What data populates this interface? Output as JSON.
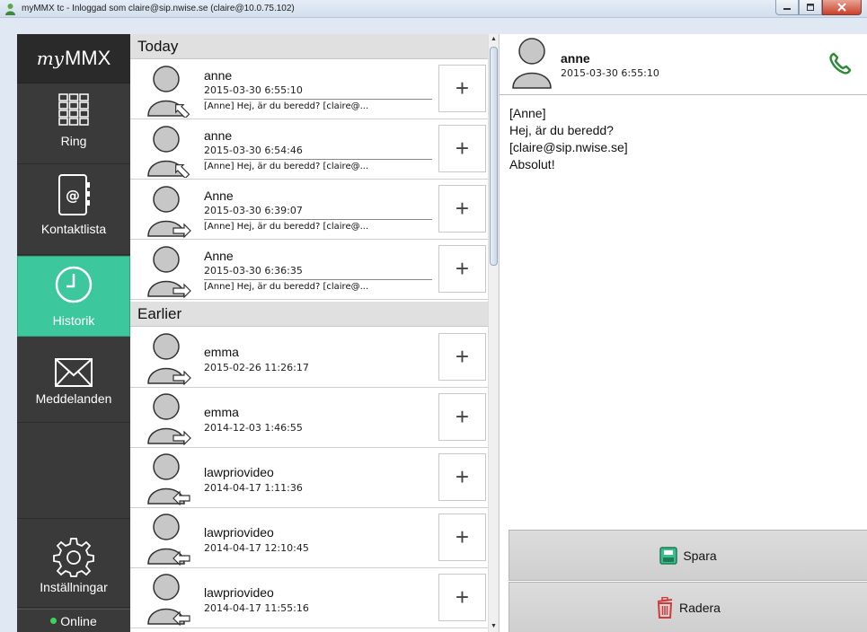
{
  "window": {
    "title": "myMMX tc - Inloggad som claire@sip.nwise.se (claire@10.0.75.102)"
  },
  "sidebar": {
    "logo_prefix": "my",
    "logo_text": "MMX",
    "items": [
      {
        "label": "Ring",
        "icon": "dialpad-icon"
      },
      {
        "label": "Kontaktlista",
        "icon": "contacts-book-icon"
      },
      {
        "label": "Historik",
        "icon": "clock-icon",
        "active": true
      },
      {
        "label": "Meddelanden",
        "icon": "envelope-icon"
      },
      {
        "label": "Inställningar",
        "icon": "gear-icon"
      }
    ],
    "status": "Online",
    "status_color": "#3fd35a",
    "active_color": "#3cc89c"
  },
  "history": {
    "sections": [
      {
        "title": "Today",
        "rows": [
          {
            "name": "anne",
            "time": "2015-03-30 6:55:10",
            "preview": "[Anne] Hej, är du beredd? [claire@...",
            "direction": "incoming"
          },
          {
            "name": "anne",
            "time": "2015-03-30 6:54:46",
            "preview": "[Anne] Hej, är du beredd? [claire@...",
            "direction": "incoming"
          },
          {
            "name": "Anne",
            "time": "2015-03-30 6:39:07",
            "preview": "[Anne] Hej, är du beredd? [claire@...",
            "direction": "outgoing"
          },
          {
            "name": "Anne",
            "time": "2015-03-30 6:36:35",
            "preview": "[Anne] Hej, är du beredd? [claire@...",
            "direction": "outgoing"
          }
        ]
      },
      {
        "title": "Earlier",
        "rows": [
          {
            "name": "emma",
            "time": "2015-02-26 11:26:17",
            "direction": "outgoing"
          },
          {
            "name": "emma",
            "time": "2014-12-03 1:46:55",
            "direction": "outgoing"
          },
          {
            "name": "lawpriovideo",
            "time": "2014-04-17 1:11:36",
            "direction": "incoming"
          },
          {
            "name": "lawpriovideo",
            "time": "2014-04-17 12:10:45",
            "direction": "incoming"
          },
          {
            "name": "lawpriovideo",
            "time": "2014-04-17 11:55:16",
            "direction": "incoming"
          }
        ]
      }
    ],
    "add_label": "+"
  },
  "detail": {
    "name": "anne",
    "time": "2015-03-30 6:55:10",
    "message_lines": [
      "[Anne]",
      "Hej, är du beredd?",
      "[claire@sip.nwise.se]",
      "Absolut!"
    ],
    "save_label": "Spara",
    "delete_label": "Radera",
    "phone_color": "#2e8b3a"
  }
}
